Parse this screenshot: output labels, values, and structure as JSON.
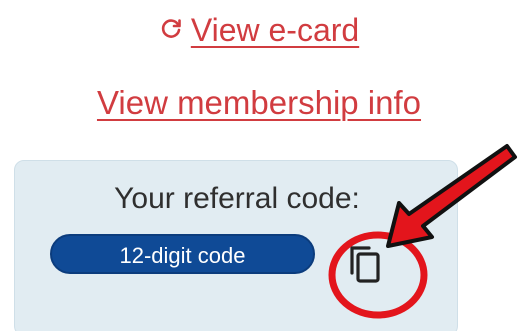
{
  "links": {
    "ecard_label": "View e-card",
    "ecard_icon": "refresh-icon",
    "membership_label": "View membership info"
  },
  "referral": {
    "label": "Your referral code:",
    "code_placeholder": "12-digit code",
    "copy_icon": "copy-icon"
  },
  "colors": {
    "link": "#d13c40",
    "card_background": "#e1ecf2",
    "code_pill": "#0f4a96",
    "annotation": "#e3151c"
  }
}
